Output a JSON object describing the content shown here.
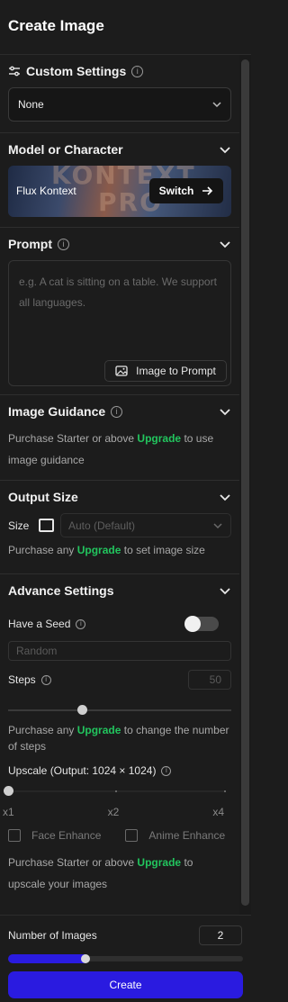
{
  "title": "Create Image",
  "custom_settings": {
    "label": "Custom Settings",
    "value": "None"
  },
  "model": {
    "label": "Model or Character",
    "name": "Flux Kontext",
    "bg_text_1": "KONTEXT",
    "bg_text_2": "PRO",
    "switch_label": "Switch"
  },
  "prompt": {
    "label": "Prompt",
    "placeholder": "e.g. A cat is sitting on a table. We support all languages.",
    "image_to_prompt": "Image to Prompt"
  },
  "image_guidance": {
    "label": "Image Guidance",
    "note_pre": "Purchase Starter or above ",
    "upgrade": "Upgrade",
    "note_post": " to use image guidance"
  },
  "output_size": {
    "label": "Output Size",
    "size_label": "Size",
    "value": "Auto (Default)",
    "note_pre": "Purchase any ",
    "upgrade": "Upgrade",
    "note_post": " to set image size"
  },
  "advance": {
    "label": "Advance Settings",
    "seed_label": "Have a Seed",
    "seed_enabled": false,
    "seed_placeholder": "Random",
    "steps_label": "Steps",
    "steps_value": "50",
    "steps_fraction": 0.33,
    "steps_note_pre": "Purchase any ",
    "upgrade": "Upgrade",
    "steps_note_post": " to change the number of steps",
    "upscale_label": "Upscale (Output: 1024 × 1024)",
    "upscale_ticks": [
      "x1",
      "x2",
      "x4"
    ],
    "face_enhance": "Face Enhance",
    "anime_enhance": "Anime Enhance",
    "upscale_note_pre": "Purchase Starter or above ",
    "upscale_note_post": " to upscale your images"
  },
  "footer": {
    "num_images_label": "Number of Images",
    "num_images": "2",
    "slider_fraction": 0.33,
    "create_label": "Create"
  },
  "colors": {
    "accent": "#2a1be0",
    "upgrade": "#22c55e",
    "background": "#1c1c1c"
  }
}
